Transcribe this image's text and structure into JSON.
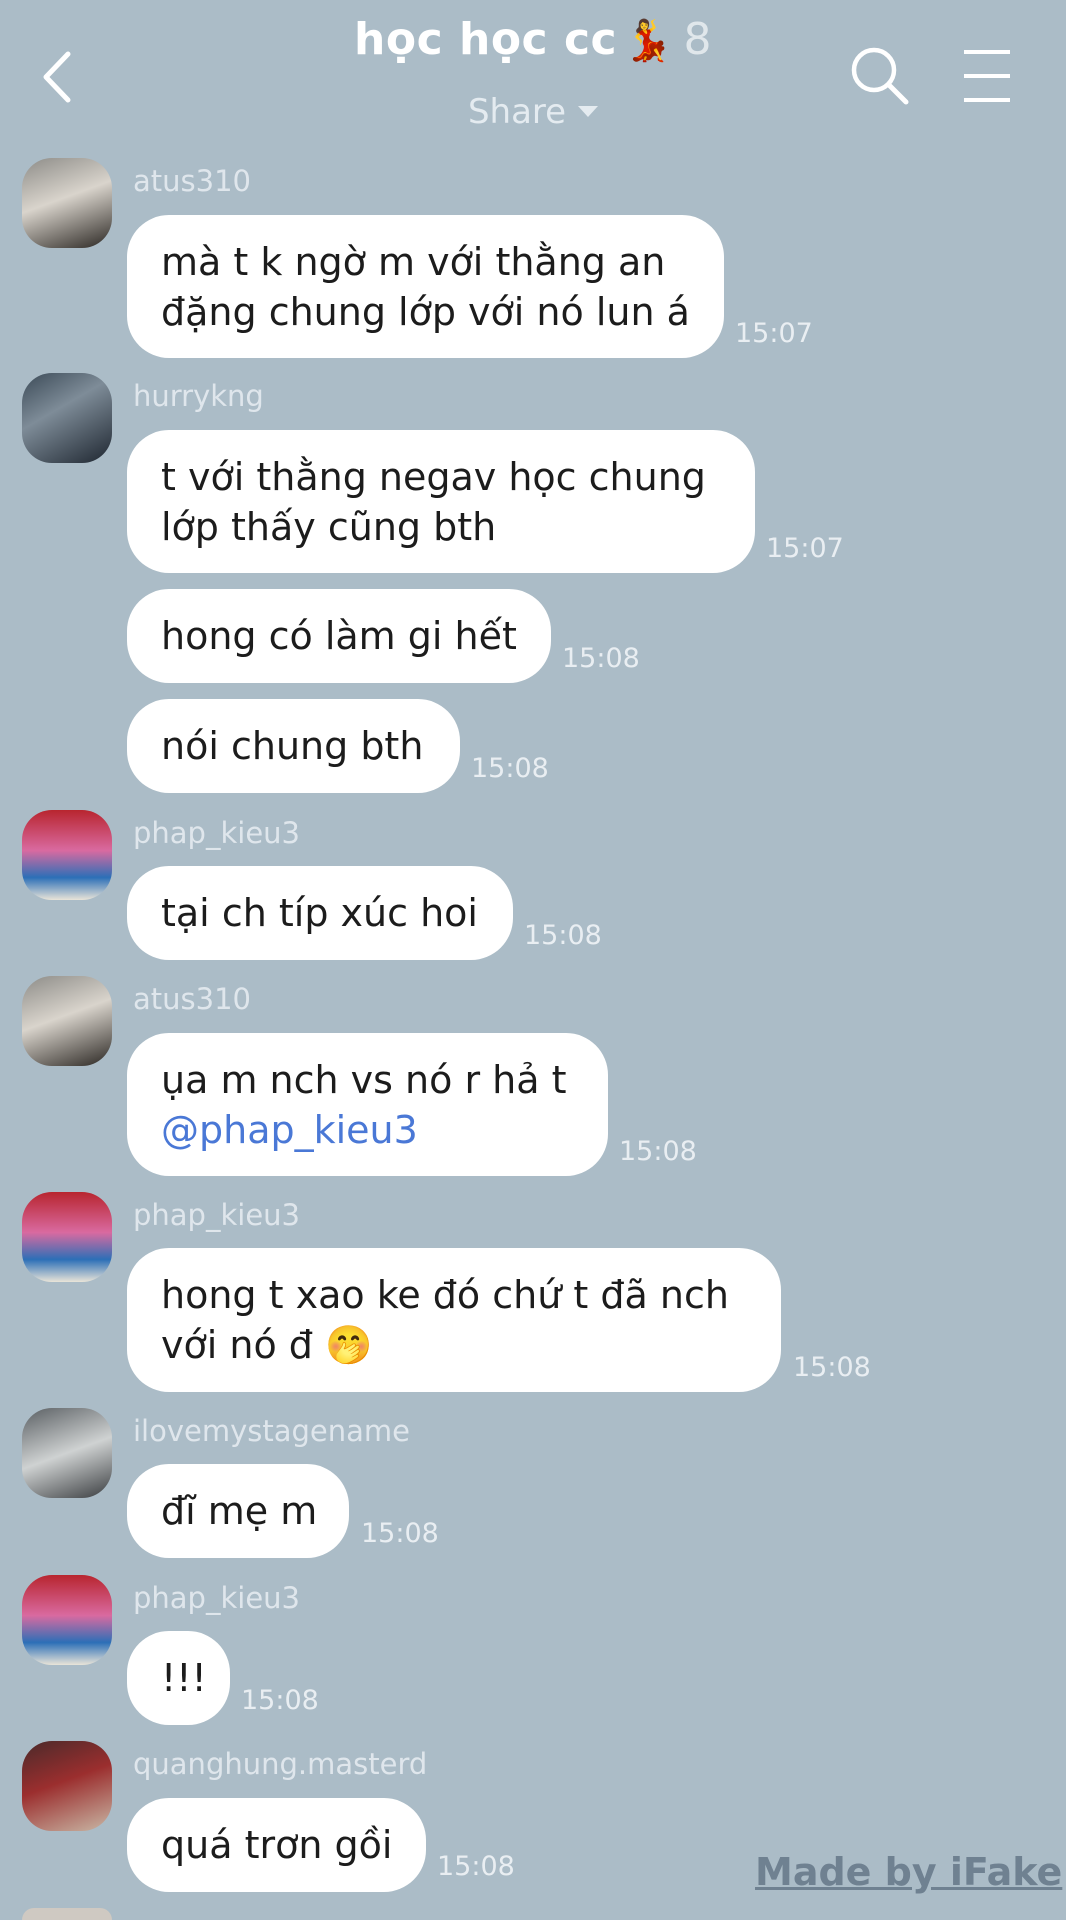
{
  "header": {
    "title": "học học cc",
    "title_emoji": "💃",
    "member_count": "8",
    "share_label": "Share"
  },
  "messages": [
    {
      "sender": "atus310",
      "lines": [
        "mà t k ngờ m với thằng an",
        "đặng chung lớp với nó lun á"
      ],
      "time": "15:07"
    },
    {
      "sender": "hurrykng",
      "lines": [
        "t với thằng negav học chung",
        "lớp thấy cũng bth"
      ],
      "time": "15:07"
    },
    {
      "lines": [
        "hong có làm gi hết"
      ],
      "time": "15:08"
    },
    {
      "lines": [
        "nói chung bth"
      ],
      "time": "15:08"
    },
    {
      "sender": "phap_kieu3",
      "lines": [
        "tại ch típ xúc hoi"
      ],
      "time": "15:08"
    },
    {
      "sender": "atus310",
      "lines": [
        "ụa m nch vs nó r hả t"
      ],
      "mention": "@phap_kieu3",
      "time": "15:08"
    },
    {
      "sender": "phap_kieu3",
      "lines": [
        "hong t xao ke đó chứ t đã nch",
        "với nó đ"
      ],
      "emoji": "🤭",
      "time": "15:08"
    },
    {
      "sender": "ilovemystagename",
      "lines": [
        "đĩ mẹ m"
      ],
      "time": "15:08"
    },
    {
      "sender": "phap_kieu3",
      "lines": [
        "!!!"
      ],
      "time": "15:08"
    },
    {
      "sender": "quanghung.masterd",
      "lines": [
        "quá trơn gồi"
      ],
      "time": "15:08"
    }
  ],
  "watermark": "Made by iFake",
  "colors": {
    "background": "#abbcc7",
    "bubble": "#ffffff",
    "mention": "#4a78d6"
  }
}
